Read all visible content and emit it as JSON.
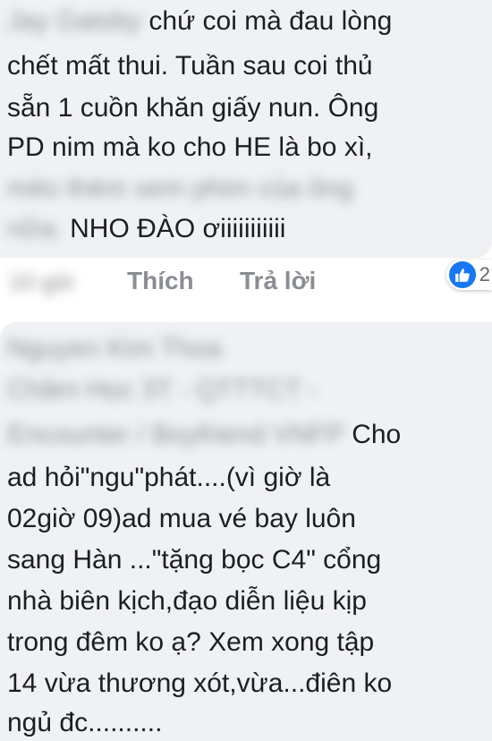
{
  "comment1": {
    "author": "Jay Gatsby",
    "lines": [
      "chứ coi mà đau lòng",
      "chết mất thui. Tuần sau coi thủ",
      "sẵn 1 cuồn khăn giấy nun. Ông",
      "PD nim mà ko cho HE là bo xì,",
      "méo thèm xem phim của ông",
      "NHO ĐÀO ơiiiiiiiiiii"
    ],
    "blurred_prefix": "nữa."
  },
  "actions": {
    "timestamp": "10 giờ",
    "like": "Thích",
    "reply": "Trả lời",
    "reaction_count": "2",
    "reaction_icon": "thumbs-up-icon"
  },
  "comment2": {
    "author": "Nguyen Kim Thoa",
    "blurred_lines": [
      "Chăm Học 3T - QTTTCT -",
      "Encounter / Boyfriend VNFP"
    ],
    "lines": [
      "Cho",
      "ad hỏi\"ngu\"phát....(vì giờ  là",
      "02giờ 09)ad mua vé bay luôn",
      "sang Hàn ...\"tặng bọc C4\" cổng",
      "nhà biên kịch,đạo diễn liệu kịp",
      "trong đêm ko ạ? Xem xong tập",
      "14  vừa thương xót,vừa...điên ko",
      "ngủ đc.........."
    ]
  },
  "colors": {
    "bubble": "#eff1f4",
    "text": "#1c1e21",
    "muted": "#8a8d91",
    "like_blue": "#1877f2"
  }
}
